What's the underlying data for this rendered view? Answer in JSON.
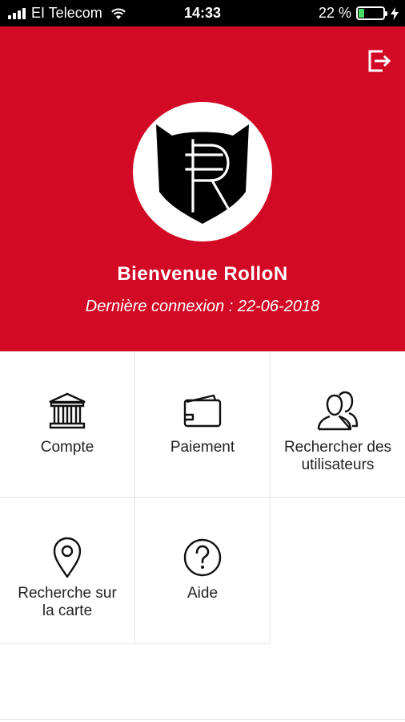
{
  "status_bar": {
    "carrier": "EI Telecom",
    "time": "14:33",
    "battery_percent": "22 %",
    "battery_level": 0.22
  },
  "header": {
    "welcome": "Bienvenue RolloN",
    "last_login": "Dernière connexion : 22-06-2018",
    "background_color": "#d20a25"
  },
  "menu": {
    "tiles": [
      {
        "label": "Compte",
        "icon": "bank-icon"
      },
      {
        "label": "Paiement",
        "icon": "wallet-icon"
      },
      {
        "label": "Rechercher des\nutilisateurs",
        "icon": "users-icon"
      },
      {
        "label": "Recherche sur\nla carte",
        "icon": "map-pin-icon"
      },
      {
        "label": "Aide",
        "icon": "help-icon"
      }
    ]
  }
}
